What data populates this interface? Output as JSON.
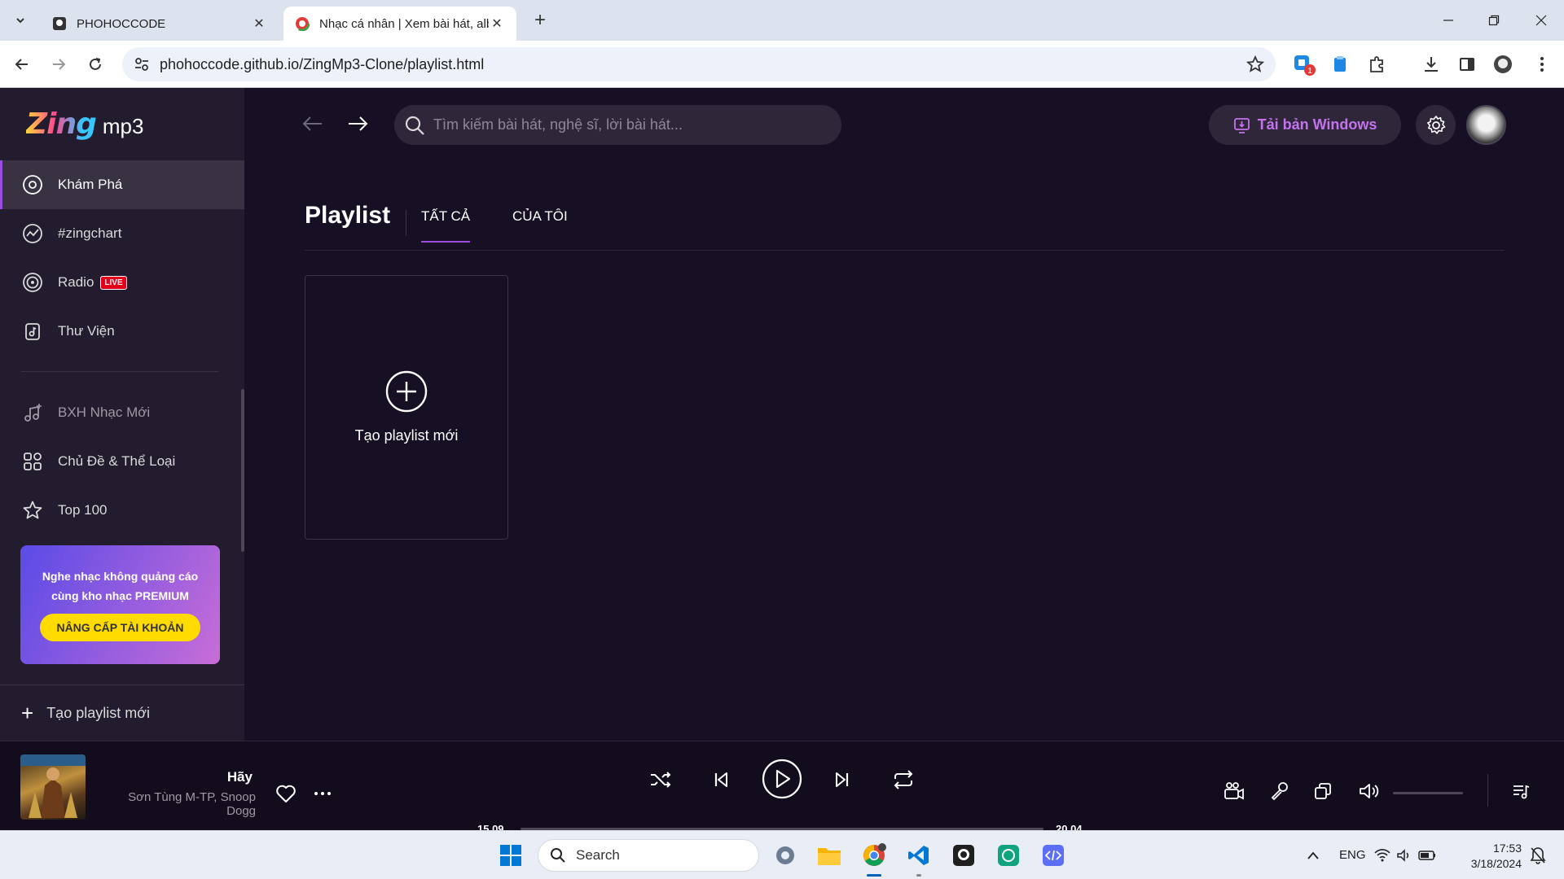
{
  "browser": {
    "tabs": [
      {
        "title": "PHOHOCCODE",
        "active": false
      },
      {
        "title": "Nhạc cá nhân | Xem bài hát, alb",
        "active": true
      }
    ],
    "url": "phohoccode.github.io/ZingMp3-Clone/playlist.html",
    "extension_badge": "1"
  },
  "app": {
    "logo": {
      "brand": "Zing",
      "suffix": "mp3"
    },
    "sidebar": {
      "items": [
        {
          "label": "Khám Phá",
          "icon": "disc-icon",
          "active": true
        },
        {
          "label": "#zingchart",
          "icon": "chart-icon"
        },
        {
          "label": "Radio",
          "icon": "radio-icon",
          "badge": "LIVE"
        },
        {
          "label": "Thư Viện",
          "icon": "library-icon"
        }
      ],
      "secondary_items": [
        {
          "label": "BXH Nhạc Mới",
          "icon": "music-note-plus-icon"
        },
        {
          "label": "Chủ Đề & Thể Loại",
          "icon": "category-icon"
        },
        {
          "label": "Top 100",
          "icon": "star-icon"
        }
      ],
      "promo": {
        "text_line1": "Nghe nhạc không quảng cáo",
        "text_line2": "cùng kho nhạc PREMIUM",
        "button": "NÂNG CẤP TÀI KHOẢN"
      },
      "create_playlist": "Tạo playlist mới"
    },
    "header": {
      "search_placeholder": "Tìm kiếm bài hát, nghệ sĩ, lời bài hát...",
      "download_button": "Tải bản Windows"
    },
    "page": {
      "title": "Playlist",
      "tabs": [
        {
          "label": "TẤT CẢ",
          "active": true
        },
        {
          "label": "CỦA TÔI",
          "active": false
        }
      ],
      "create_card_label": "Tạo playlist mới"
    },
    "player": {
      "song": "Hãy",
      "artist": "Sơn Tùng M-TP, Snoop Dogg",
      "current_time": "15.09",
      "duration": "20.04",
      "progress": 0,
      "volume": 0
    }
  },
  "taskbar": {
    "search_label": "Search",
    "language": "ENG",
    "time": "17:53",
    "date": "3/18/2024"
  },
  "colors": {
    "accent": "#9b4de0",
    "app_bg": "#170f23",
    "sidebar_bg": "#231b2e",
    "download_text": "#c273ed",
    "promo_button": "#ffdb00"
  }
}
